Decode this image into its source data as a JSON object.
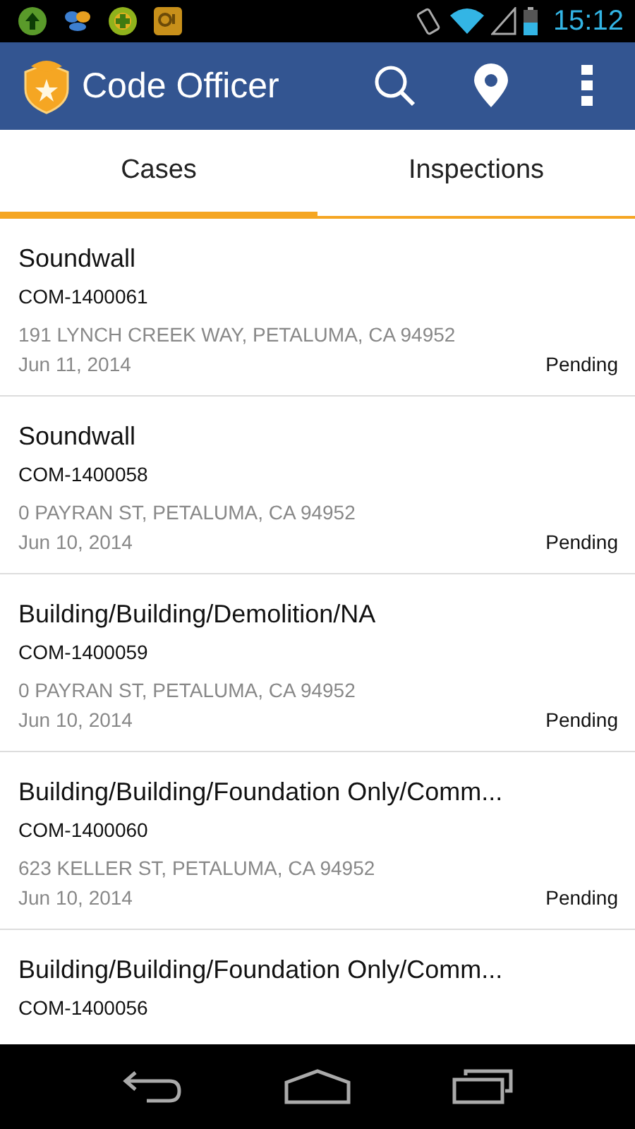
{
  "status_bar": {
    "time": "15:12"
  },
  "app_bar": {
    "title": "Code Officer"
  },
  "tabs": [
    {
      "label": "Cases",
      "selected": true
    },
    {
      "label": "Inspections",
      "selected": false
    }
  ],
  "cases": [
    {
      "title": "Soundwall",
      "case_number": "COM-1400061",
      "address": "191 LYNCH CREEK WAY, PETALUMA, CA 94952",
      "date": "Jun 11, 2014",
      "status": "Pending"
    },
    {
      "title": "Soundwall",
      "case_number": "COM-1400058",
      "address": "0 PAYRAN ST, PETALUMA, CA 94952",
      "date": "Jun 10, 2014",
      "status": "Pending"
    },
    {
      "title": "Building/Building/Demolition/NA",
      "case_number": "COM-1400059",
      "address": "0 PAYRAN ST, PETALUMA, CA 94952",
      "date": "Jun 10, 2014",
      "status": "Pending"
    },
    {
      "title": "Building/Building/Foundation Only/Comm...",
      "case_number": "COM-1400060",
      "address": "623 KELLER ST, PETALUMA, CA 94952",
      "date": "Jun 10, 2014",
      "status": "Pending"
    },
    {
      "title": "Building/Building/Foundation Only/Comm...",
      "case_number": "COM-1400056"
    }
  ]
}
